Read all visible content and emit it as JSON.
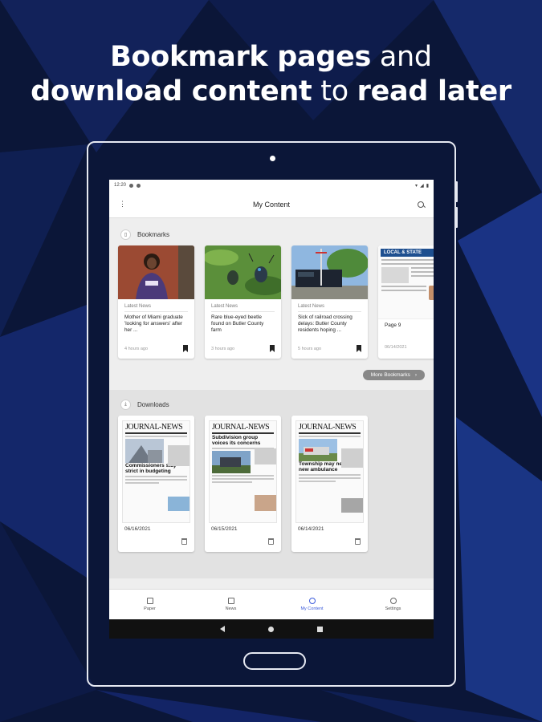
{
  "headline": {
    "line1_bold": "Bookmark pages",
    "line1_light": "and",
    "line2_bold": "download content",
    "line2_light": "to",
    "line2_bold2": "read later"
  },
  "status_bar": {
    "time": "12:20"
  },
  "app_bar": {
    "title": "My Content"
  },
  "bookmarks": {
    "section_label": "Bookmarks",
    "items": [
      {
        "category": "Latest News",
        "headline": "Mother of Miami graduate 'looking for answers' after her ...",
        "time": "4 hours ago"
      },
      {
        "category": "Latest News",
        "headline": "Rare blue-eyed beetle found on Butler County farm",
        "time": "3 hours ago"
      },
      {
        "category": "Latest News",
        "headline": "Sick of railroad crossing delays: Butler County residents hoping ...",
        "time": "5 hours ago"
      },
      {
        "category": "",
        "headline": "Page 9",
        "time": "06/14/2021",
        "paper_banner": "LOCAL & STATE"
      }
    ],
    "more_label": "More Bookmarks",
    "more_icon": "chevron-right-icon"
  },
  "downloads": {
    "section_label": "Downloads",
    "items": [
      {
        "masthead": "JOURNAL-NEWS",
        "headline": "Commissioners stay strict in budgeting",
        "date": "06/16/2021"
      },
      {
        "masthead": "JOURNAL-NEWS",
        "headline": "Subdivision group voices its concerns",
        "date": "06/15/2021"
      },
      {
        "masthead": "JOURNAL-NEWS",
        "headline": "Township may need 2nd new ambulance",
        "date": "06/14/2021"
      }
    ]
  },
  "bottom_nav": {
    "items": [
      {
        "label": "Paper",
        "icon": "paper-icon"
      },
      {
        "label": "News",
        "icon": "news-icon"
      },
      {
        "label": "My Content",
        "icon": "person-icon",
        "active": true
      },
      {
        "label": "Settings",
        "icon": "gear-icon"
      }
    ]
  },
  "colors": {
    "accent": "#3b5bdb",
    "background": "#0b1638"
  }
}
